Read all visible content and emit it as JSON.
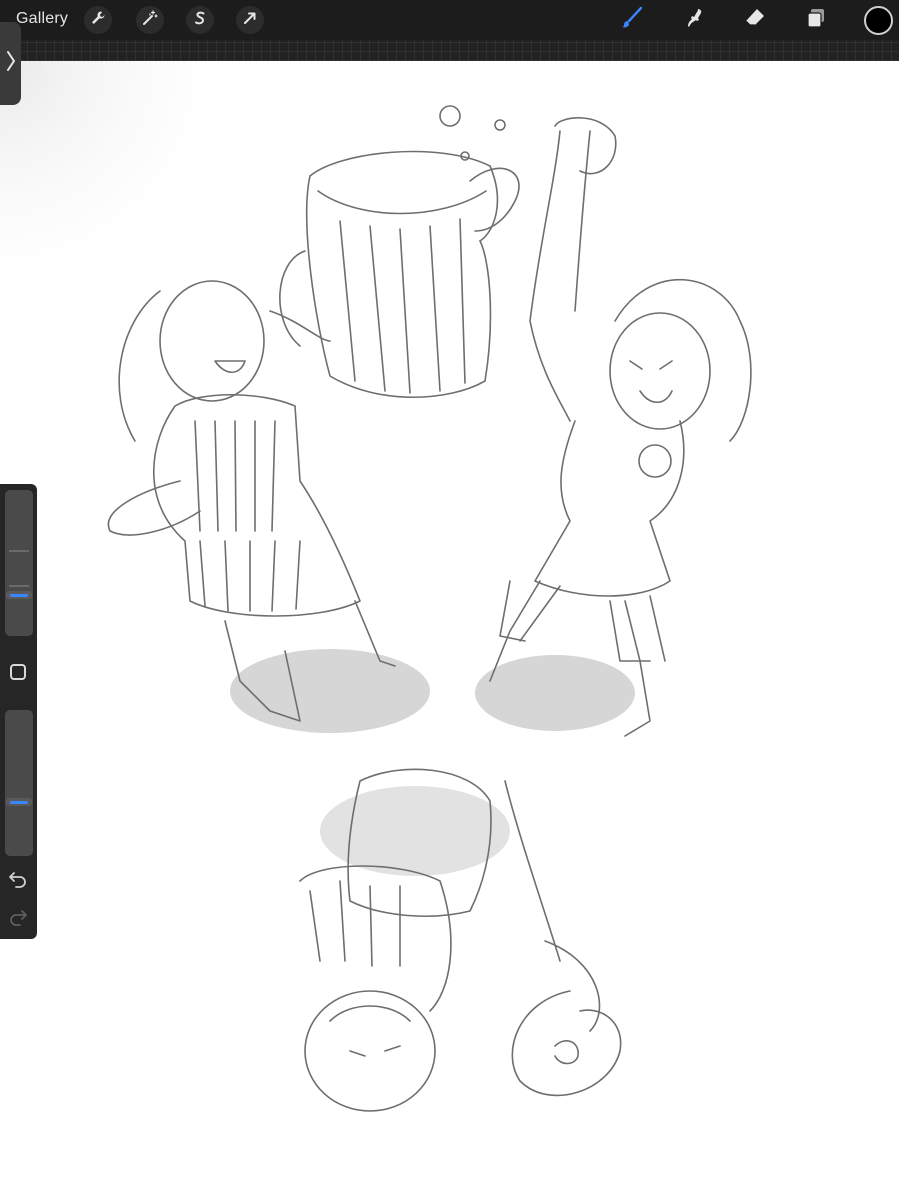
{
  "toolbar": {
    "gallery_label": "Gallery",
    "left_tools": [
      {
        "icon": "wrench-icon",
        "name": "actions"
      },
      {
        "icon": "magic-wand-icon",
        "name": "adjustments"
      },
      {
        "icon": "selection-s-icon",
        "name": "selection"
      },
      {
        "icon": "arrow-cursor-icon",
        "name": "transform"
      }
    ],
    "right_tools": [
      {
        "icon": "brush-icon",
        "name": "paint",
        "active": true
      },
      {
        "icon": "smudge-icon",
        "name": "smudge"
      },
      {
        "icon": "eraser-icon",
        "name": "eraser"
      },
      {
        "icon": "layers-icon",
        "name": "layers"
      }
    ],
    "current_color": "#000000",
    "accent_color": "#3a86ff"
  },
  "sidebar": {
    "brush_size_level": 0.27,
    "brush_opacity_level": 0.36,
    "undo_enabled": true,
    "redo_enabled": false
  },
  "canvas": {
    "background": "#ffffff",
    "content": "pencil-sketch-artwork"
  }
}
